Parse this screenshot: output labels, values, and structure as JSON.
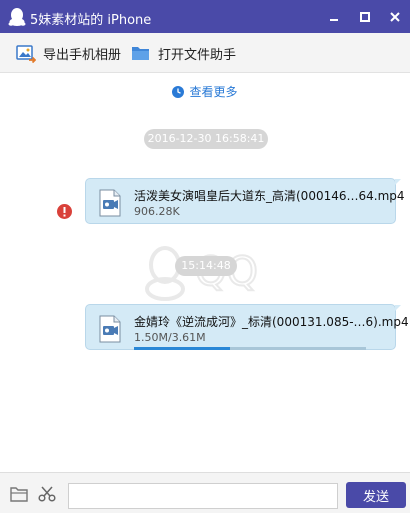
{
  "window": {
    "title": "5妹素材站的 iPhone",
    "icons": {
      "app": "qq-penguin-icon",
      "minimize": "minimize-icon",
      "maximize": "maximize-icon",
      "close": "close-icon"
    }
  },
  "toolbar": {
    "export_label": "导出手机相册",
    "open_folder_label": "打开文件助手"
  },
  "chat": {
    "see_more": "查看更多",
    "messages": [
      {
        "timestamp": "2016-12-30 16:58:41",
        "file_name": "活泼美女演唱皇后大道东_高清(000146…64.mp4",
        "file_size": "906.28K",
        "status": "error"
      },
      {
        "timestamp": "15:14:48",
        "file_name": "金婧玲《逆流成河》_标清(000131.085-…6).mp4",
        "file_size": "1.50M/3.61M",
        "progress_fraction": 0.415,
        "status": "uploading"
      }
    ]
  },
  "watermark_text": "QQ",
  "composer": {
    "input_value": "",
    "send_label": "发送"
  },
  "colors": {
    "titlebar": "#4a4aa8",
    "bubble": "#d4eaf6",
    "link": "#2a7ad6",
    "error": "#d9413a",
    "progress": "#2a87d6"
  }
}
